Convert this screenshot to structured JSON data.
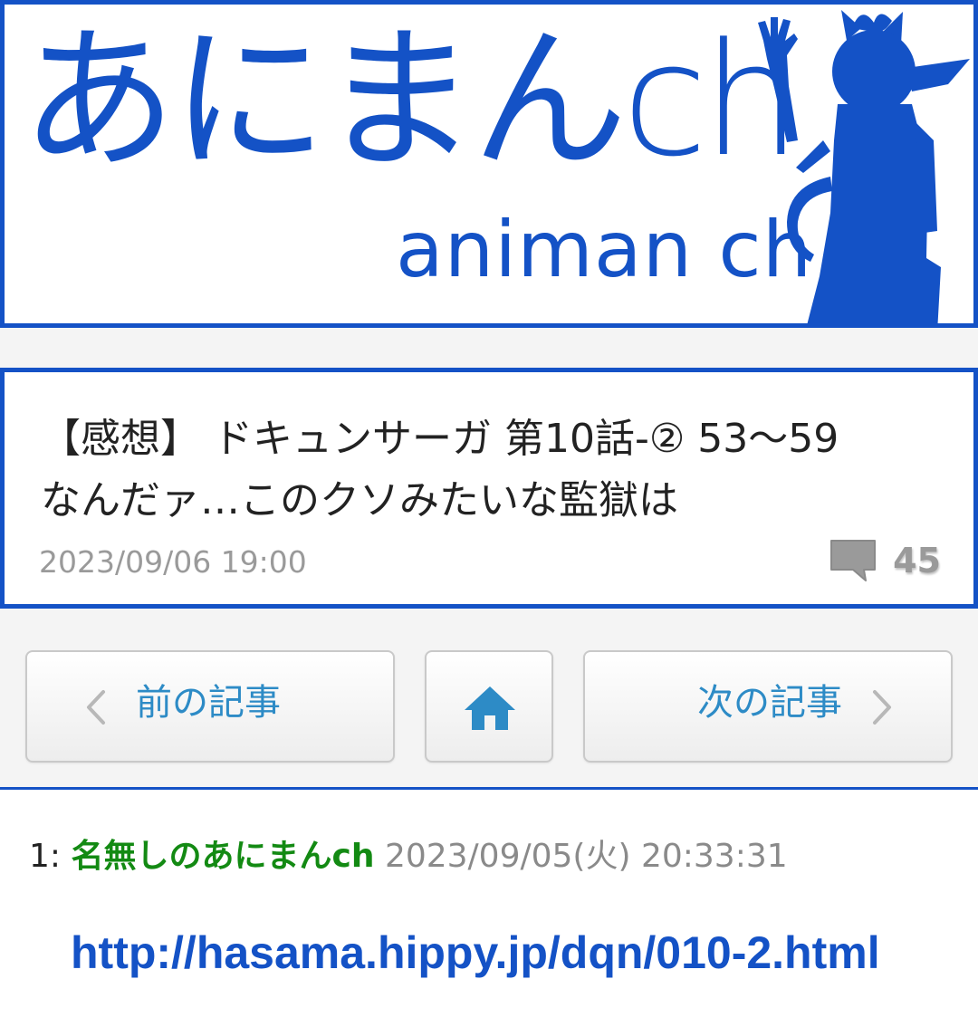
{
  "header": {
    "logo_jp": "あにまんch",
    "logo_en": "animan ch",
    "brand_color": "#1452c6"
  },
  "article": {
    "title_line1": "【感想】 ドキュンサーガ 第10話-② 53〜59",
    "title_line2": "なんだァ…このクソみたいな監獄は",
    "date": "2023/09/06 19:00",
    "comment_icon": "comment-icon",
    "comment_count": "45"
  },
  "nav": {
    "prev_label": "前の記事",
    "home_icon": "home-icon",
    "next_label": "次の記事",
    "accent": "#2d8bc6"
  },
  "post": {
    "number": "1:",
    "name": "名無しのあにまんch",
    "date": "2023/09/05(火) 20:33:31",
    "link": "http://hasama.hippy.jp/dqn/010-2.html",
    "name_color": "#138a13"
  }
}
